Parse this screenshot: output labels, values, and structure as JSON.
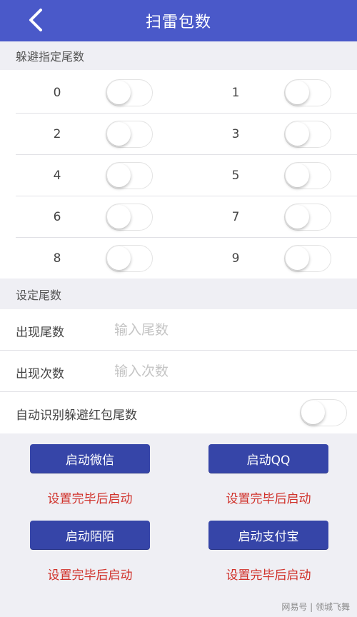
{
  "nav": {
    "title": "扫雷包数"
  },
  "avoid": {
    "header": "躲避指定尾数",
    "digits": [
      {
        "label": "0",
        "on": false
      },
      {
        "label": "1",
        "on": false
      },
      {
        "label": "2",
        "on": false
      },
      {
        "label": "3",
        "on": false
      },
      {
        "label": "4",
        "on": false
      },
      {
        "label": "5",
        "on": false
      },
      {
        "label": "6",
        "on": false
      },
      {
        "label": "7",
        "on": false
      },
      {
        "label": "8",
        "on": false
      },
      {
        "label": "9",
        "on": false
      }
    ]
  },
  "settings": {
    "header": "设定尾数",
    "appear_tail": {
      "label": "出现尾数",
      "value": "",
      "placeholder": "输入尾数"
    },
    "appear_count": {
      "label": "出现次数",
      "value": "",
      "placeholder": "输入次数"
    },
    "auto_detect": {
      "label": "自动识别躲避红包尾数",
      "on": false
    }
  },
  "actions": {
    "wechat": "启动微信",
    "qq": "启动QQ",
    "momo": "启动陌陌",
    "alipay": "启动支付宝",
    "hint": "设置完毕后启动"
  },
  "watermark": "网易号 | 领城飞舞"
}
